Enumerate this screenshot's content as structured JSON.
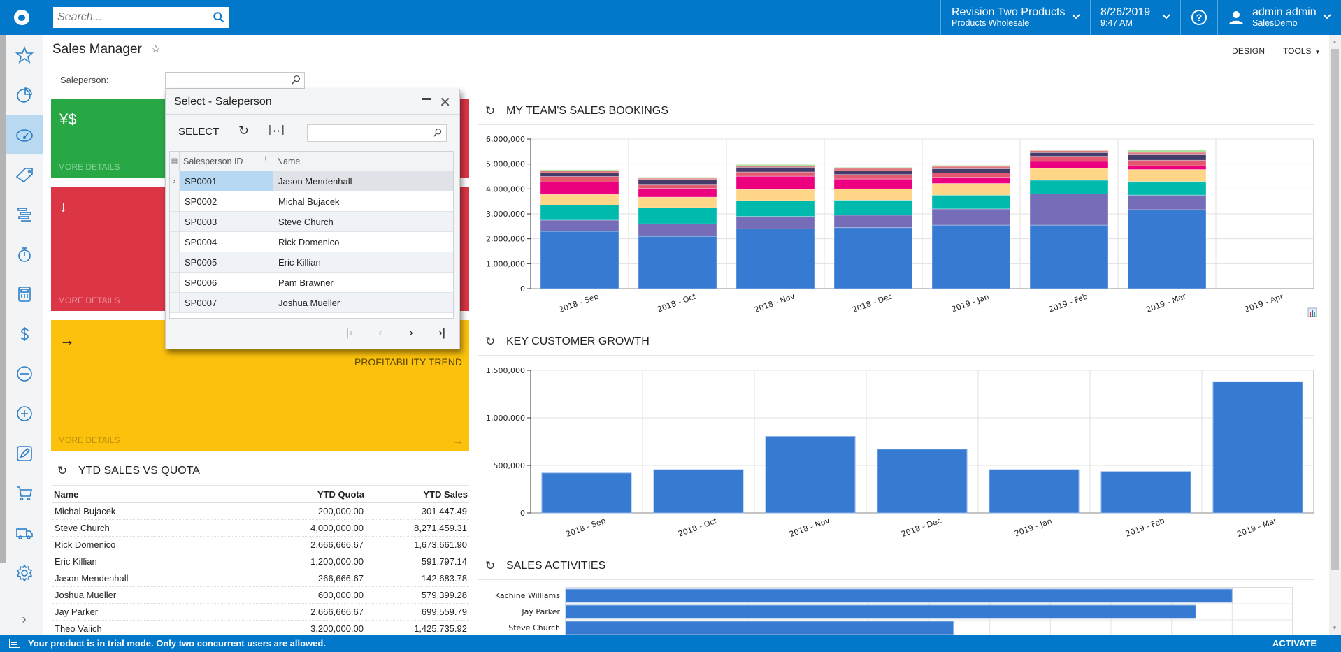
{
  "topbar": {
    "search_placeholder": "Search...",
    "branch": {
      "main": "Revision Two Products",
      "sub": "Products Wholesale"
    },
    "datetime": {
      "date": "8/26/2019",
      "time": "9:47 AM"
    },
    "help": "?",
    "user": {
      "name": "admin admin",
      "company": "SalesDemo"
    }
  },
  "sidebar": {
    "items": [
      {
        "name": "favorites",
        "icon": "star-icon"
      },
      {
        "name": "dashboards",
        "icon": "pie-chart-icon"
      },
      {
        "name": "data-views",
        "icon": "speedometer-icon",
        "active": true
      },
      {
        "name": "sales",
        "icon": "tag-icon"
      },
      {
        "name": "projects",
        "icon": "gantt-icon"
      },
      {
        "name": "time",
        "icon": "stopwatch-icon"
      },
      {
        "name": "finance",
        "icon": "calculator-icon"
      },
      {
        "name": "banking",
        "icon": "dollar-icon"
      },
      {
        "name": "payables",
        "icon": "minus-circle-icon"
      },
      {
        "name": "receivables",
        "icon": "plus-circle-icon"
      },
      {
        "name": "documents",
        "icon": "edit-icon"
      },
      {
        "name": "purchases",
        "icon": "cart-icon"
      },
      {
        "name": "inventory",
        "icon": "truck-icon"
      },
      {
        "name": "configuration",
        "icon": "gear-icon"
      }
    ],
    "expand": "›"
  },
  "page": {
    "title": "Sales Manager",
    "favorite": "☆",
    "design_label": "DESIGN",
    "tools_label": "TOOLS",
    "saleperson_label": "Saleperson:",
    "saleperson_value": ""
  },
  "tiles": {
    "green": {
      "icon": "¥$",
      "more": "MORE DETAILS"
    },
    "red": {
      "icon": "↓",
      "more": "MORE DETAILS"
    },
    "yellow": {
      "icon": "→",
      "caption": "PROFITABILITY TREND",
      "more": "MORE DETAILS",
      "arrow": "→"
    }
  },
  "dialog": {
    "title": "Select - Saleperson",
    "select_label": "SELECT",
    "search_value": "",
    "columns": [
      "Salesperson ID",
      "Name"
    ],
    "sort_indicator": "↑",
    "rows": [
      {
        "id": "SP0001",
        "name": "Jason Mendenhall",
        "selected": true
      },
      {
        "id": "SP0002",
        "name": "Michal Bujacek"
      },
      {
        "id": "SP0003",
        "name": "Steve Church"
      },
      {
        "id": "SP0004",
        "name": "Rick Domenico"
      },
      {
        "id": "SP0005",
        "name": "Eric Killian"
      },
      {
        "id": "SP0006",
        "name": "Pam Brawner"
      },
      {
        "id": "SP0007",
        "name": "Joshua Mueller"
      }
    ],
    "pager": {
      "first": "|‹",
      "prev": "‹",
      "next": "›",
      "last": "›|"
    }
  },
  "ytd": {
    "title": "YTD SALES VS QUOTA",
    "columns": [
      "Name",
      "YTD Quota",
      "YTD Sales"
    ],
    "rows": [
      [
        "Michal Bujacek",
        "200,000.00",
        "301,447.49"
      ],
      [
        "Steve Church",
        "4,000,000.00",
        "8,271,459.31"
      ],
      [
        "Rick Domenico",
        "2,666,666.67",
        "1,673,661.90"
      ],
      [
        "Eric Killian",
        "1,200,000.00",
        "591,797.14"
      ],
      [
        "Jason Mendenhall",
        "266,666.67",
        "142,683.78"
      ],
      [
        "Joshua Mueller",
        "600,000.00",
        "579,399.28"
      ],
      [
        "Jay Parker",
        "2,666,666.67",
        "699,559.79"
      ],
      [
        "Theo Valich",
        "3,200,000.00",
        "1,425,735.92"
      ]
    ]
  },
  "status": {
    "message": "Your product is in trial mode. Only two concurrent users are allowed.",
    "activate_label": "ACTIVATE"
  },
  "chart_data": [
    {
      "id": "bookings",
      "type": "bar",
      "stacked": true,
      "title": "MY TEAM'S SALES BOOKINGS",
      "xlabel": "",
      "ylabel": "",
      "ylim": [
        0,
        6000000
      ],
      "yticks": [
        0,
        1000000,
        2000000,
        3000000,
        4000000,
        5000000,
        6000000
      ],
      "ytick_labels": [
        "0",
        "1,000,000",
        "2,000,000",
        "3,000,000",
        "4,000,000",
        "5,000,000",
        "6,000,000"
      ],
      "grid": true,
      "legend": "none",
      "categories": [
        "2018 - Sep",
        "2018 - Oct",
        "2018 - Nov",
        "2018 - Dec",
        "2019 - Jan",
        "2019 - Feb",
        "2019 - Mar",
        "2019 - Apr"
      ],
      "series": [
        {
          "name": "Series 1",
          "color": "#367bd1",
          "values": [
            2300000,
            2100000,
            2400000,
            2450000,
            2550000,
            2550000,
            3170000,
            0
          ]
        },
        {
          "name": "Series 2",
          "color": "#756db8",
          "values": [
            450000,
            500000,
            500000,
            500000,
            650000,
            1250000,
            580000,
            0
          ]
        },
        {
          "name": "Series 3",
          "color": "#00bbad",
          "values": [
            600000,
            650000,
            630000,
            600000,
            550000,
            550000,
            550000,
            0
          ]
        },
        {
          "name": "Series 4",
          "color": "#ffd587",
          "values": [
            430000,
            420000,
            450000,
            450000,
            470000,
            480000,
            480000,
            0
          ]
        },
        {
          "name": "Series 5",
          "color": "#ec0080",
          "values": [
            500000,
            350000,
            530000,
            400000,
            250000,
            280000,
            150000,
            0
          ]
        },
        {
          "name": "Series 6",
          "color": "#e4586f",
          "values": [
            220000,
            140000,
            170000,
            180000,
            170000,
            200000,
            220000,
            0
          ]
        },
        {
          "name": "Series 7",
          "color": "#453c6b",
          "values": [
            150000,
            220000,
            190000,
            150000,
            170000,
            150000,
            220000,
            0
          ]
        },
        {
          "name": "Series 8",
          "color": "#e0777a",
          "values": [
            80000,
            50000,
            50000,
            100000,
            100000,
            80000,
            100000,
            0
          ]
        },
        {
          "name": "Series 9",
          "color": "#a8e4a0",
          "values": [
            40000,
            40000,
            60000,
            40000,
            40000,
            40000,
            100000,
            0
          ]
        }
      ]
    },
    {
      "id": "key_customer",
      "type": "bar",
      "title": "KEY CUSTOMER GROWTH",
      "xlabel": "",
      "ylabel": "",
      "ylim": [
        0,
        1500000
      ],
      "yticks": [
        0,
        500000,
        1000000,
        1500000
      ],
      "ytick_labels": [
        "0",
        "500,000",
        "1,000,000",
        "1,500,000"
      ],
      "grid": true,
      "legend": "none",
      "categories": [
        "2018 - Sep",
        "2018 - Oct",
        "2018 - Nov",
        "2018 - Dec",
        "2019 - Jan",
        "2019 - Feb",
        "2019 - Mar"
      ],
      "values": [
        420000,
        455000,
        805000,
        670000,
        455000,
        435000,
        1380000
      ],
      "color": "#367bd1"
    },
    {
      "id": "activities",
      "type": "bar",
      "orientation": "horizontal",
      "title": "SALES ACTIVITIES",
      "xlabel": "",
      "ylabel": "",
      "xlim": [
        0,
        12
      ],
      "grid": true,
      "legend": "none",
      "categories": [
        "Kachine Williams",
        "Jay Parker",
        "Steve Church"
      ],
      "values": [
        11.0,
        10.4,
        6.4
      ],
      "color": "#367bd1"
    }
  ]
}
